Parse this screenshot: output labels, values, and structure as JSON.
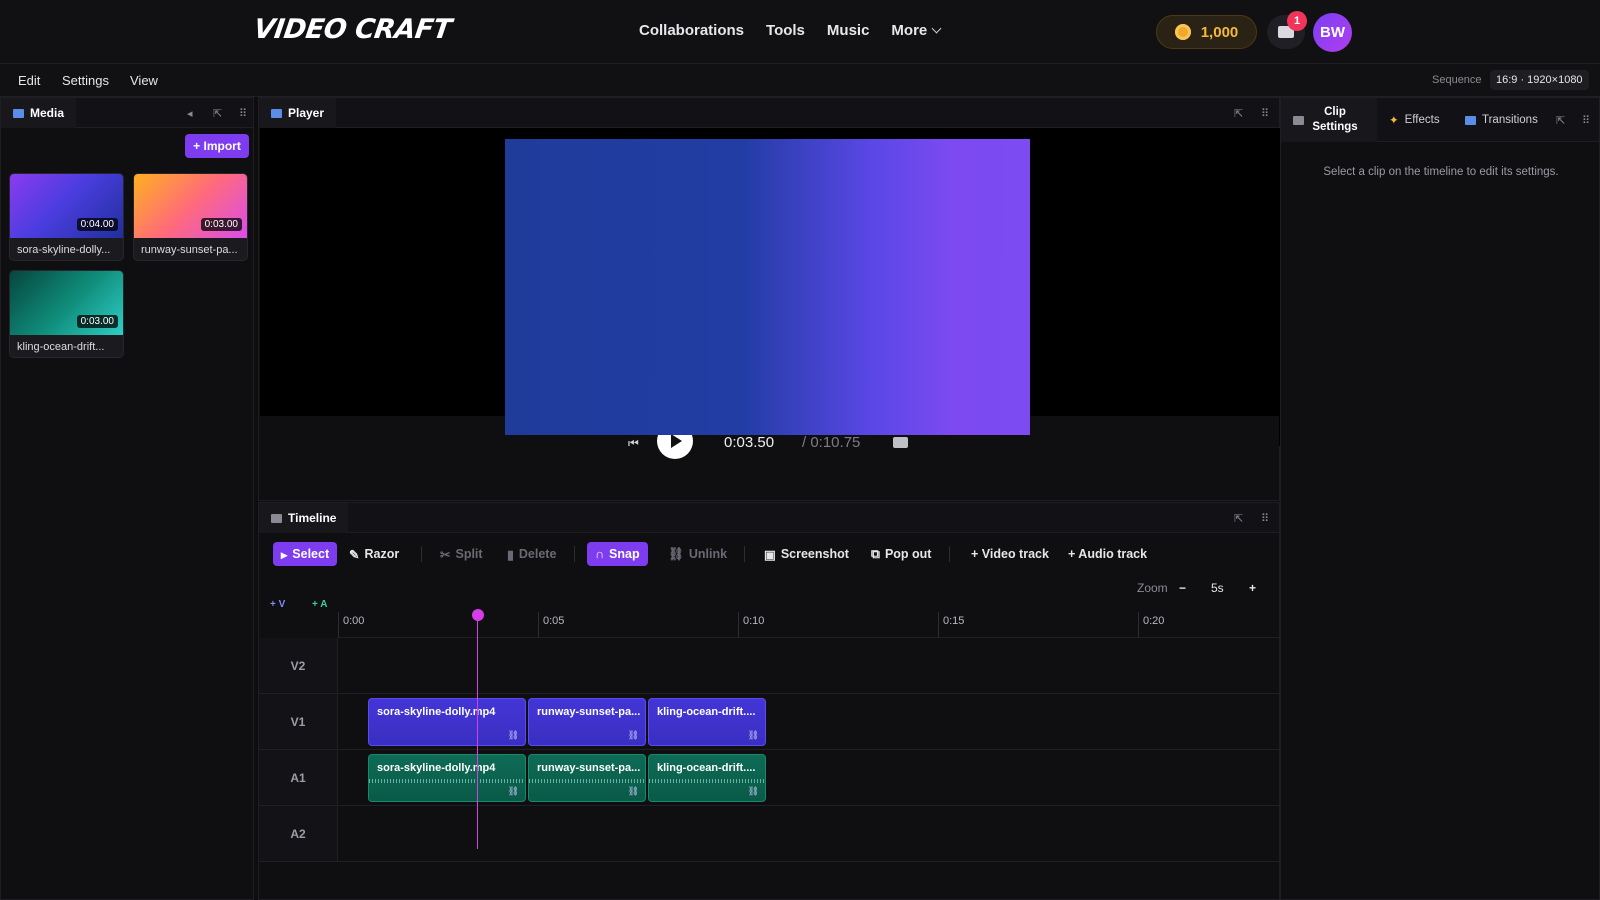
{
  "header": {
    "logo": "VIDEO CRAFT",
    "nav": [
      "Collaborations",
      "Tools",
      "Music",
      "More"
    ],
    "coins": "1,000",
    "notifications": "1",
    "avatar_initials": "BW"
  },
  "menu": {
    "items": [
      "Edit",
      "Settings",
      "View"
    ],
    "sequence_label": "Sequence",
    "sequence_value": "16:9 · 1920×1080"
  },
  "media": {
    "title": "Media",
    "import_label": "+ Import",
    "items": [
      {
        "name": "sora-skyline-dolly...",
        "duration": "0:04.00"
      },
      {
        "name": "runway-sunset-pa...",
        "duration": "0:03.00"
      },
      {
        "name": "kling-ocean-drift...",
        "duration": "0:03.00"
      }
    ]
  },
  "player": {
    "title": "Player",
    "current_time": "0:03.50",
    "total_time": "/ 0:10.75"
  },
  "timeline": {
    "title": "Timeline",
    "tools": {
      "select": "Select",
      "razor": "Razor",
      "split": "Split",
      "delete": "Delete",
      "snap": "Snap",
      "unlink": "Unlink",
      "screenshot": "Screenshot",
      "popout": "Pop out",
      "add_video": "+ Video track",
      "add_audio": "+ Audio track"
    },
    "zoom_label": "Zoom",
    "zoom_minus": "−",
    "zoom_value": "5s",
    "zoom_plus": "+",
    "add_v": "+ V",
    "add_a": "+ A",
    "ruler": [
      "0:00",
      "0:05",
      "0:10",
      "0:15",
      "0:20"
    ],
    "tracks": [
      "V2",
      "V1",
      "A1",
      "A2"
    ],
    "clips": {
      "v1": [
        "sora-skyline-dolly.mp4",
        "runway-sunset-pa...",
        "kling-ocean-drift...."
      ],
      "a1": [
        "sora-skyline-dolly.mp4",
        "runway-sunset-pa...",
        "kling-ocean-drift...."
      ]
    }
  },
  "inspector": {
    "tabs": [
      "Clip Settings",
      "Effects",
      "Transitions"
    ],
    "hint": "Select a clip on the timeline to edit its settings."
  }
}
